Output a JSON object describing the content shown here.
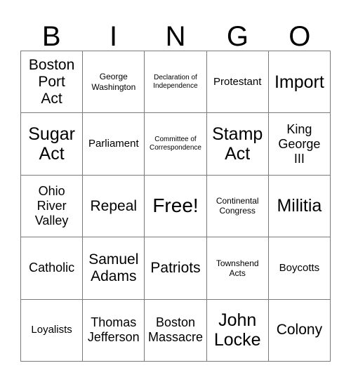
{
  "card": {
    "header_letters": [
      "B",
      "I",
      "N",
      "G",
      "O"
    ],
    "columns": [
      {
        "letter": "B",
        "cells": [
          {
            "text": "Boston\nPort\nAct",
            "size": "xl",
            "free_space": false
          },
          {
            "text": "Sugar\nAct",
            "size": "xxl",
            "free_space": false
          },
          {
            "text": "Ohio\nRiver\nValley",
            "size": "lg",
            "free_space": false
          },
          {
            "text": "Catholic",
            "size": "lg",
            "free_space": false
          },
          {
            "text": "Loyalists",
            "size": "md",
            "free_space": false
          }
        ]
      },
      {
        "letter": "I",
        "cells": [
          {
            "text": "George\nWashington",
            "size": "sm",
            "free_space": false
          },
          {
            "text": "Parliament",
            "size": "md",
            "free_space": false
          },
          {
            "text": "Repeal",
            "size": "xl",
            "free_space": false
          },
          {
            "text": "Samuel\nAdams",
            "size": "xl",
            "free_space": false
          },
          {
            "text": "Thomas\nJefferson",
            "size": "lg",
            "free_space": false
          }
        ]
      },
      {
        "letter": "N",
        "cells": [
          {
            "text": "Declaration of\nIndependence",
            "size": "xs",
            "free_space": false
          },
          {
            "text": "Committee of\nCorrespondence",
            "size": "xs",
            "free_space": false
          },
          {
            "text": "Free!",
            "size": "free",
            "free_space": true
          },
          {
            "text": "Patriots",
            "size": "xl",
            "free_space": false
          },
          {
            "text": "Boston\nMassacre",
            "size": "lg",
            "free_space": false
          }
        ]
      },
      {
        "letter": "G",
        "cells": [
          {
            "text": "Protestant",
            "size": "md",
            "free_space": false
          },
          {
            "text": "Stamp\nAct",
            "size": "xxl",
            "free_space": false
          },
          {
            "text": "Continental\nCongress",
            "size": "sm",
            "free_space": false
          },
          {
            "text": "Townshend\nActs",
            "size": "sm",
            "free_space": false
          },
          {
            "text": "John\nLocke",
            "size": "xxl",
            "free_space": false
          }
        ]
      },
      {
        "letter": "O",
        "cells": [
          {
            "text": "Import",
            "size": "xxl",
            "free_space": false
          },
          {
            "text": "King\nGeorge\nIII",
            "size": "lg",
            "free_space": false
          },
          {
            "text": "Militia",
            "size": "xxl",
            "free_space": false
          },
          {
            "text": "Boycotts",
            "size": "md",
            "free_space": false
          },
          {
            "text": "Colony",
            "size": "xl",
            "free_space": false
          }
        ]
      }
    ],
    "colors": {
      "background": "#ffffff",
      "text": "#000000",
      "border": "#7a7a7a"
    }
  }
}
